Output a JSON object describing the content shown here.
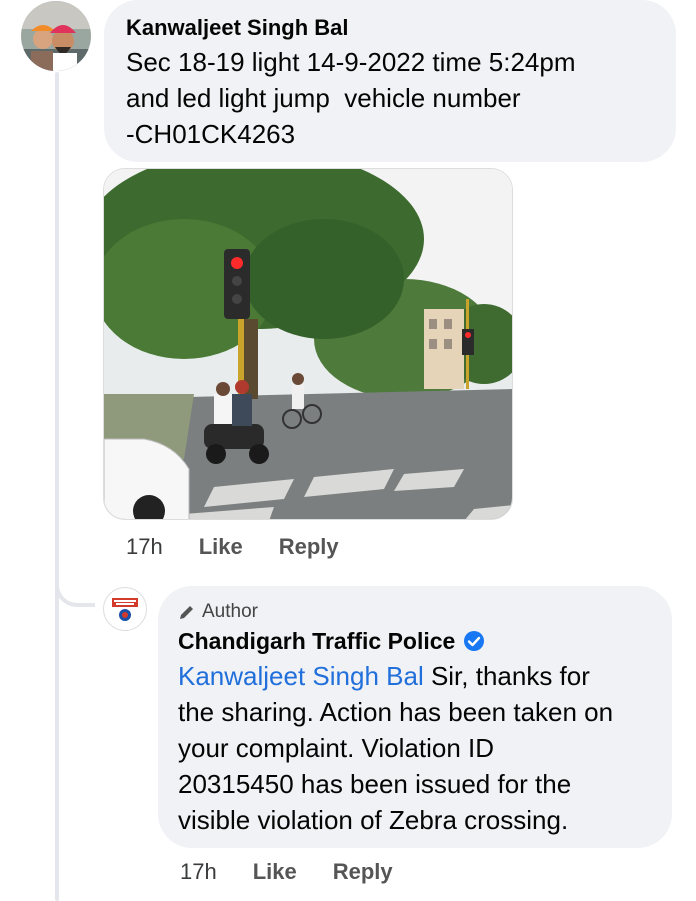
{
  "comment": {
    "author": "Kanwaljeet Singh Bal",
    "lines": [
      "Sec 18-19 light 14-9-2022 time 5:24pm",
      "and led light jump  vehicle number",
      "-CH01CK4263"
    ],
    "time": "17h",
    "like": "Like",
    "reply": "Reply"
  },
  "reply_comment": {
    "tag": "Author",
    "author": "Chandigarh Traffic Police",
    "mention": "Kanwaljeet Singh Bal",
    "text_first": " Sir, thanks for",
    "lines": [
      "the sharing. Action has been taken on",
      "your complaint. Violation ID",
      "20315450 has been issued for the",
      "visible violation of Zebra crossing."
    ],
    "time": "17h",
    "like": "Like",
    "reply": "Reply"
  },
  "colors": {
    "bubble": "#f0f2f5",
    "mention": "#216fdb",
    "verified": "#1877f2"
  }
}
